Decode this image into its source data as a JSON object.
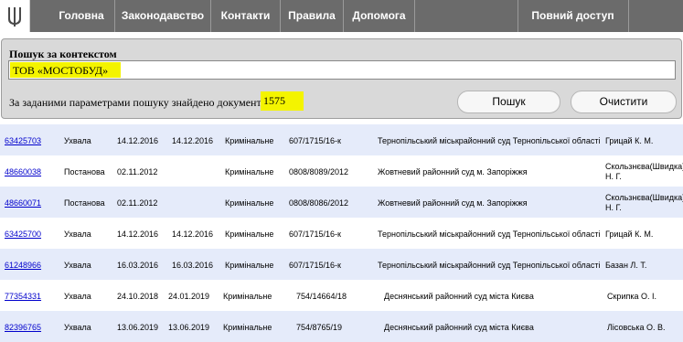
{
  "nav": {
    "items": [
      "Головна",
      "Законодавство",
      "Контакти",
      "Правила",
      "Допомога"
    ],
    "full_access": "Повний доступ"
  },
  "search": {
    "label": "Пошук за контекстом",
    "value": "ТОВ «МОСТОБУД»",
    "result_text": "За заданими параметрами пошуку знайдено документів:",
    "result_count": "1575",
    "search_button": "Пошук",
    "clear_button": "Очистити"
  },
  "results": [
    {
      "id": "63425703",
      "type": "Ухвала",
      "date_decision": "14.12.2016",
      "date_reg": "14.12.2016",
      "category": "Кримінальне",
      "case": "607/1715/16-к",
      "court": "Тернопільський міськрайонний суд Тернопільської області",
      "judge": "Грицай К. М."
    },
    {
      "id": "48660038",
      "type": "Постанова",
      "date_decision": "02.11.2012",
      "date_reg": "",
      "category": "Кримінальне",
      "case": "0808/8089/2012",
      "court": "Жовтневий районний суд м. Запоріжжя",
      "judge": "Скользнєва(Швидка) Н. Г."
    },
    {
      "id": "48660071",
      "type": "Постанова",
      "date_decision": "02.11.2012",
      "date_reg": "",
      "category": "Кримінальне",
      "case": "0808/8086/2012",
      "court": "Жовтневий районний суд м. Запоріжжя",
      "judge": "Скользнєва(Швидка) Н. Г."
    },
    {
      "id": "63425700",
      "type": "Ухвала",
      "date_decision": "14.12.2016",
      "date_reg": "14.12.2016",
      "category": "Кримінальне",
      "case": "607/1715/16-к",
      "court": "Тернопільський міськрайонний суд Тернопільської області",
      "judge": "Грицай К. М."
    },
    {
      "id": "61248966",
      "type": "Ухвала",
      "date_decision": "16.03.2016",
      "date_reg": "16.03.2016",
      "category": "Кримінальне",
      "case": "607/1715/16-к",
      "court": "Тернопільський міськрайонний суд Тернопільської області",
      "judge": "Базан Л. Т."
    },
    {
      "id": "77354331",
      "type": "Ухвала",
      "date_decision": "24.10.2018",
      "date_reg": "24.01.2019",
      "category": "Кримінальне",
      "case": "754/14664/18",
      "court": "Деснянський районний суд міста Києва",
      "judge": "Скрипка О. І."
    },
    {
      "id": "82396765",
      "type": "Ухвала",
      "date_decision": "13.06.2019",
      "date_reg": "13.06.2019",
      "category": "Кримінальне",
      "case": "754/8765/19",
      "court": "Деснянський районний суд міста Києва",
      "judge": "Лісовська О. В."
    }
  ]
}
